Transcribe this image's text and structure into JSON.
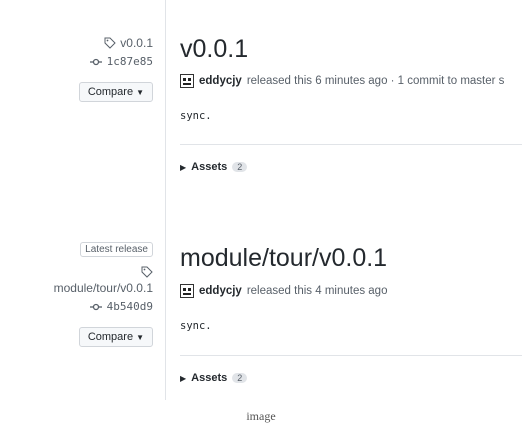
{
  "releases": [
    {
      "tag": "v0.0.1",
      "commit": "1c87e85",
      "compare_label": "Compare",
      "title": "v0.0.1",
      "author": "eddycjy",
      "byline_rest": "released this 6 minutes ago · 1 commit to master s",
      "body": "sync.",
      "assets_label": "Assets",
      "assets_count": "2"
    },
    {
      "badge": "Latest release",
      "tag": "module/tour/v0.0.1",
      "commit": "4b540d9",
      "compare_label": "Compare",
      "title": "module/tour/v0.0.1",
      "author": "eddycjy",
      "byline_rest": "released this 4 minutes ago",
      "body": "sync.",
      "assets_label": "Assets",
      "assets_count": "2"
    }
  ],
  "caption": "image"
}
